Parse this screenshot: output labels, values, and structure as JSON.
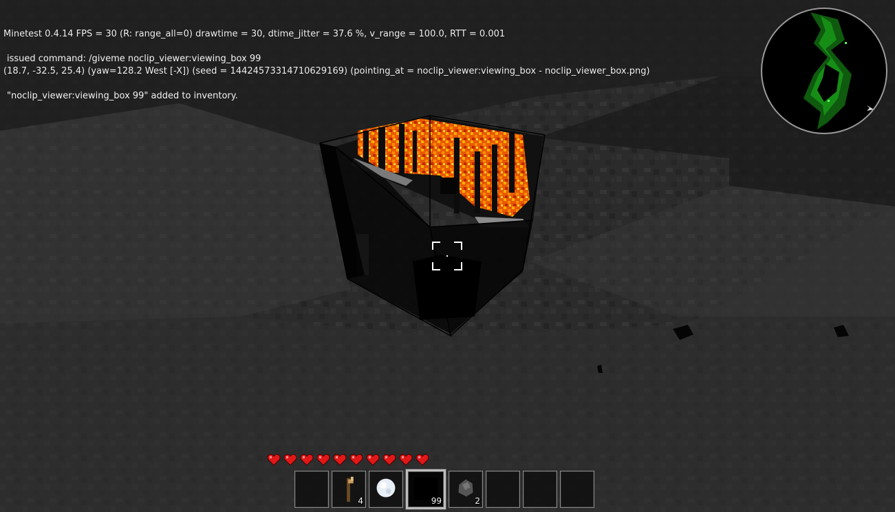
{
  "hud": {
    "debug_line1": "Minetest 0.4.14 FPS = 30 (R: range_all=0) drawtime = 30, dtime_jitter = 37.6 %, v_range = 100.0, RTT = 0.001",
    "debug_line2": "(18.7, -32.5, 25.4) (yaw=128.2 West [-X]) (seed = 14424573314710629169) (pointing_at = noclip_viewer:viewing_box - noclip_viewer_box.png)"
  },
  "chat": {
    "lines": [
      "issued command: /giveme noclip_viewer:viewing_box 99",
      "\"noclip_viewer:viewing_box 99\" added to inventory."
    ]
  },
  "health": {
    "hearts": 10
  },
  "hotbar": {
    "selected_index": 3,
    "slots": [
      {
        "item": "",
        "count": ""
      },
      {
        "item": "stick-torch-icon",
        "count": "4"
      },
      {
        "item": "snowball-icon",
        "count": ""
      },
      {
        "item": "viewing-box-icon",
        "count": "99"
      },
      {
        "item": "coal-lump-icon",
        "count": "2"
      },
      {
        "item": "",
        "count": ""
      },
      {
        "item": "",
        "count": ""
      },
      {
        "item": "",
        "count": ""
      }
    ]
  },
  "colors": {
    "text": "#f2f2f2",
    "heart": "#e01818",
    "lava": "#ff7a00",
    "minimap_green": "#1aa01a"
  }
}
